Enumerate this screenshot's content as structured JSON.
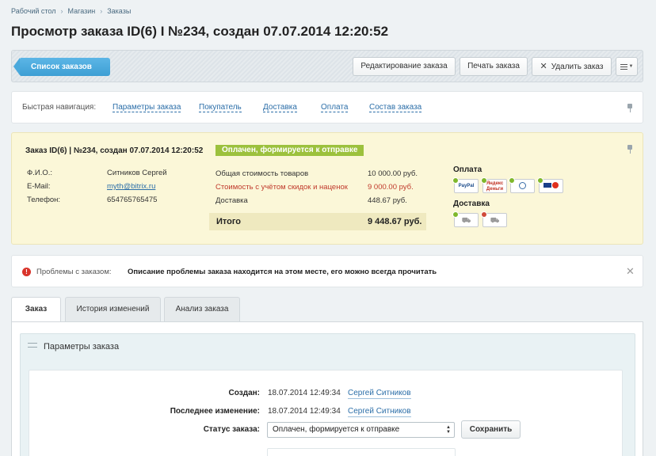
{
  "breadcrumb": [
    "Рабочий стол",
    "Магазин",
    "Заказы"
  ],
  "page_title": "Просмотр заказа ID(6) I №234, создан 07.07.2014 12:20:52",
  "toolbar": {
    "back_label": "Список заказов",
    "edit_label": "Редактирование заказа",
    "print_label": "Печать заказа",
    "delete_label": "Удалить заказ"
  },
  "quicknav": {
    "label": "Быстрая навигация:",
    "links": [
      "Параметры заказа",
      "Покупатель",
      "Доставка",
      "Оплата",
      "Состав заказа"
    ]
  },
  "summary": {
    "title": "Заказ ID(6) | №234, создан 07.07.2014 12:20:52",
    "status": "Оплачен, формируется к отправке",
    "customer": [
      {
        "label": "Ф.И.О.:",
        "value": "Ситников Сергей"
      },
      {
        "label": "E-Mail:",
        "value": "myth@bitrix.ru"
      },
      {
        "label": "Телефон:",
        "value": "654765765475"
      }
    ],
    "costs": [
      {
        "label": "Общая стоимость товаров",
        "value": "10 000.00 руб."
      },
      {
        "label": "Стоимость с учётом скидок и наценок",
        "value": "9 000.00 руб."
      },
      {
        "label": "Доставка",
        "value": "448.67 руб."
      }
    ],
    "total_label": "Итого",
    "total_value": "9 448.67 руб.",
    "payment_title": "Оплата",
    "payment_icons": [
      "PayPal",
      "Яндекс Деньги",
      "webmoney",
      "visa-mastercard"
    ],
    "payment_status": [
      "paid",
      "paid",
      "paid",
      "paid"
    ],
    "delivery_title": "Доставка",
    "delivery_status": [
      "shipped",
      "not-shipped"
    ],
    "status_colors": {
      "paid": "#7fb82b",
      "not_paid": "#d04a3a",
      "badge": "#9cc13d"
    }
  },
  "problems": {
    "label": "Проблемы с заказом:",
    "text": "Описание проблемы заказа находится на этом месте, его можно всегда прочитать"
  },
  "tabs": [
    {
      "label": "Заказ",
      "active": true
    },
    {
      "label": "История изменений",
      "active": false
    },
    {
      "label": "Анализ заказа",
      "active": false
    }
  ],
  "params": {
    "title": "Параметры заказа",
    "created_label": "Создан:",
    "created_value": "18.07.2014 12:49:34",
    "created_user": "Сергей Ситников",
    "modified_label": "Последнее изменение:",
    "modified_value": "18.07.2014 12:49:34",
    "modified_user": "Сергей Ситников",
    "status_label": "Статус заказа:",
    "status_value": "Оплачен, формируется к отправке",
    "save_label": "Сохранить"
  }
}
